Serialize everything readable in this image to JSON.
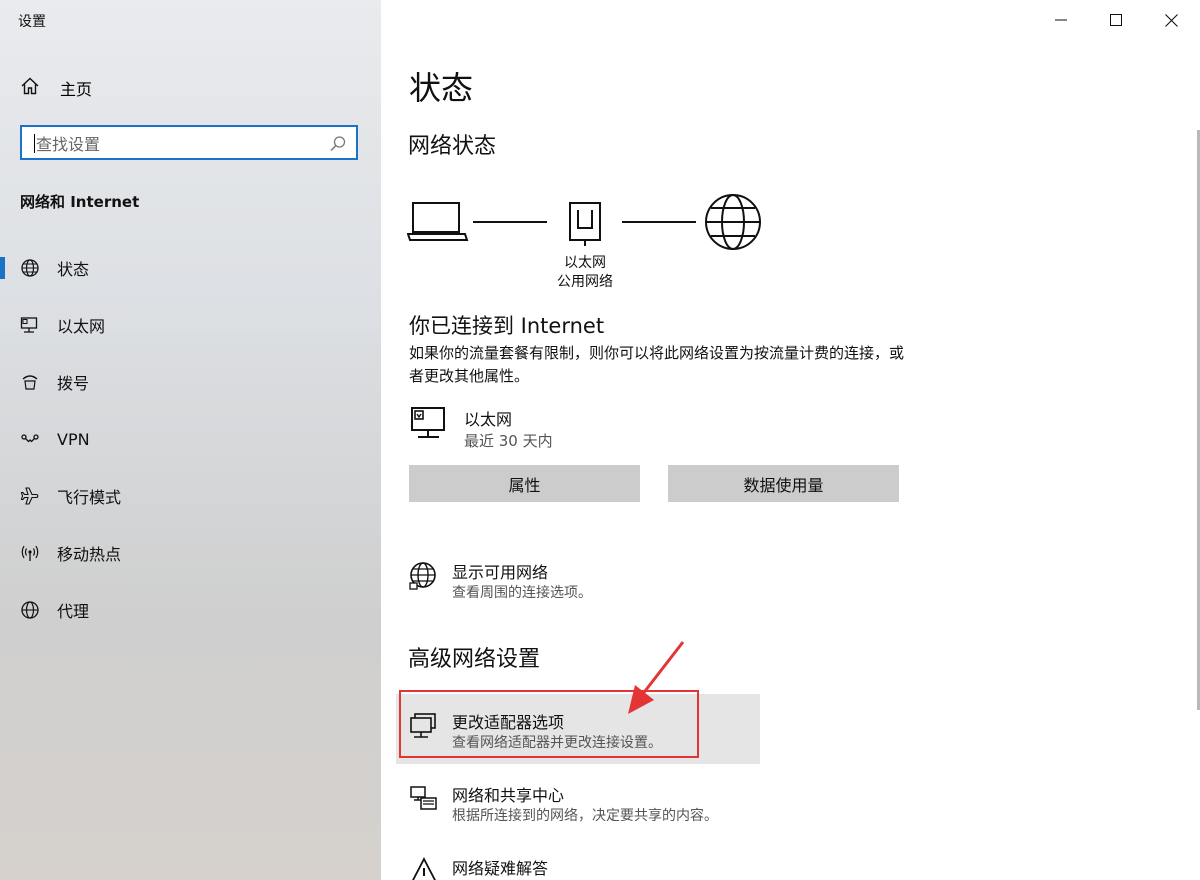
{
  "window": {
    "title": "设置",
    "controls": {
      "minimize": "minimize",
      "maximize": "maximize",
      "close": "close"
    }
  },
  "sidebar": {
    "home_label": "主页",
    "search_placeholder": "查找设置",
    "section_title": "网络和 Internet",
    "items": [
      {
        "label": "状态",
        "icon": "globe-icon",
        "active": true
      },
      {
        "label": "以太网",
        "icon": "ethernet-icon",
        "active": false
      },
      {
        "label": "拨号",
        "icon": "dialup-icon",
        "active": false
      },
      {
        "label": "VPN",
        "icon": "vpn-icon",
        "active": false
      },
      {
        "label": "飞行模式",
        "icon": "airplane-icon",
        "active": false
      },
      {
        "label": "移动热点",
        "icon": "hotspot-icon",
        "active": false
      },
      {
        "label": "代理",
        "icon": "globe-icon",
        "active": false
      }
    ],
    "accent_color": "#1a73c7"
  },
  "main": {
    "page_title": "状态",
    "network_status_heading": "网络状态",
    "diagram": {
      "adapter_name": "以太网",
      "network_type": "公用网络"
    },
    "connected_title": "你已连接到 Internet",
    "connected_desc": "如果你的流量套餐有限制，则你可以将此网络设置为按流量计费的连接，或者更改其他属性。",
    "ethernet": {
      "name": "以太网",
      "subtitle": "最近 30 天内"
    },
    "buttons": {
      "properties": "属性",
      "data_usage": "数据使用量"
    },
    "show_networks": {
      "title": "显示可用网络",
      "desc": "查看周围的连接选项。"
    },
    "advanced_heading": "高级网络设置",
    "advanced_items": [
      {
        "title": "更改适配器选项",
        "desc": "查看网络适配器并更改连接设置。",
        "icon": "adapter-icon",
        "highlighted": true
      },
      {
        "title": "网络和共享中心",
        "desc": "根据所连接到的网络，决定要共享的内容。",
        "icon": "sharing-center-icon",
        "highlighted": false
      },
      {
        "title": "网络疑难解答",
        "desc": "",
        "icon": "warning-icon",
        "highlighted": false
      }
    ],
    "annotation_color": "#e33535"
  }
}
